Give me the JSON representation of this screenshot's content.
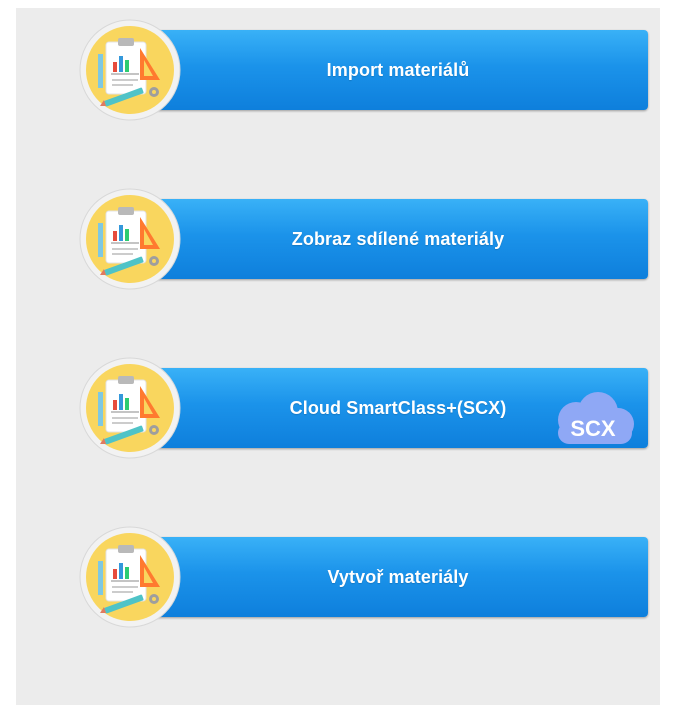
{
  "menu": {
    "items": [
      {
        "label": "Import materiálů",
        "icon": "materials-icon"
      },
      {
        "label": "Zobraz sdílené materiály",
        "icon": "materials-icon"
      },
      {
        "label": "Cloud SmartClass+(SCX)",
        "icon": "materials-icon",
        "badge": "SCX"
      },
      {
        "label": "Vytvoř materiály",
        "icon": "materials-icon"
      }
    ]
  },
  "colors": {
    "button_top": "#39b1f7",
    "button_bottom": "#0e7fdc",
    "icon_circle": "#f9d65e",
    "cloud": "#8fa8f5",
    "panel_background": "#ececec"
  }
}
